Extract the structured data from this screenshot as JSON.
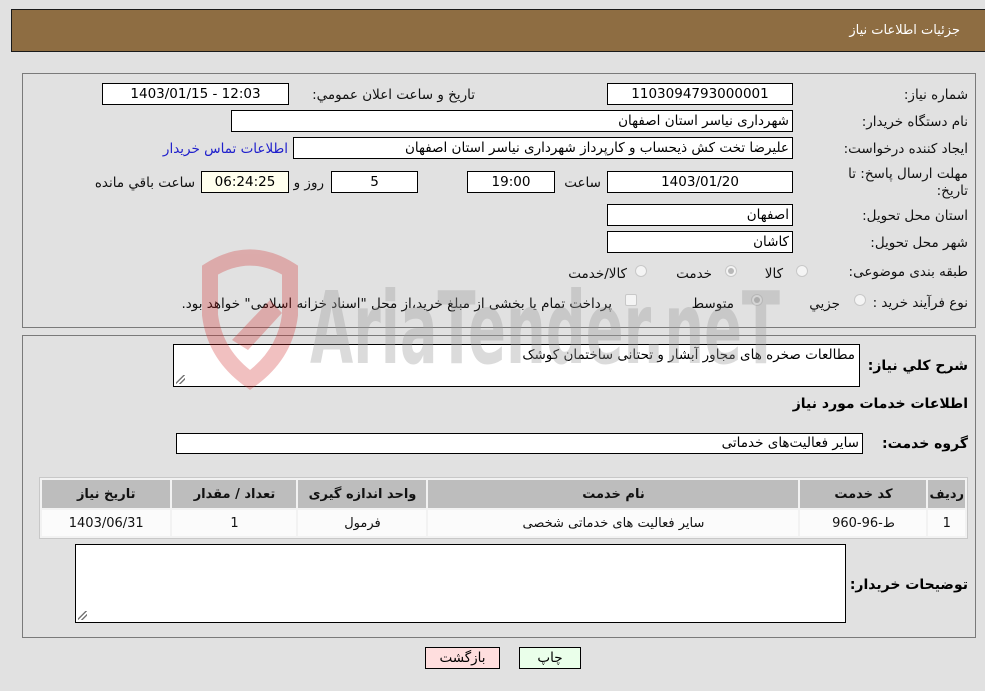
{
  "header": {
    "title": "جزئیات اطلاعات نیاز"
  },
  "form": {
    "need_number": {
      "label": "شماره نیاز:",
      "value": "1103094793000001"
    },
    "announce_datetime": {
      "label": "تاریخ و ساعت اعلان عمومي:",
      "value": "1403/01/15 - 12:03"
    },
    "buyer_org": {
      "label": "نام دستگاه خريدار:",
      "value": "شهرداری نیاسر استان اصفهان"
    },
    "requester": {
      "label": "ایجاد کننده درخواست:",
      "value": "علیرضا  تخت کش ذیحساب و کارپرداز شهرداری نیاسر استان اصفهان"
    },
    "buyer_contact_link": "اطلاعات تماس خريدار",
    "deadline": {
      "label": "مهلت ارسال پاسخ: تا تاریخ:",
      "date": "1403/01/20",
      "time_label": "ساعت",
      "time": "19:00",
      "days": "5",
      "days_label": "روز و",
      "remaining": "06:24:25",
      "remaining_label": "ساعت باقي مانده"
    },
    "delivery_province": {
      "label": "استان محل تحویل:",
      "value": "اصفهان"
    },
    "delivery_city": {
      "label": "شهر محل تحویل:",
      "value": "کاشان"
    },
    "category": {
      "label": "طبقه بندی موضوعی:",
      "options": [
        "کالا",
        "خدمت",
        "کالا/خدمت"
      ],
      "selected": "خدمت"
    },
    "purchase_type": {
      "label": "نوع فرآیند خرید :",
      "options": [
        "جزیي",
        "متوسط"
      ],
      "selected": "متوسط",
      "treasury_checkbox_label": "پرداخت تمام یا بخشی از مبلغ خرید،از محل \"اسناد خزانه اسلامی\" خواهد بود.",
      "treasury_checked": false
    }
  },
  "details": {
    "description_label": "شرح کلي نیاز:",
    "description": "مطالعات صخره های مجاور آبشار و تحتانی ساختمان کوشک",
    "services_heading": "اطلاعات خدمات مورد نیاز",
    "service_group_label": "گروه خدمت:",
    "service_group": "سایر فعالیت‌های خدماتی",
    "table": {
      "headers": [
        "ردیف",
        "کد خدمت",
        "نام خدمت",
        "واحد اندازه گیری",
        "تعداد / مقدار",
        "تاریخ نیاز"
      ],
      "rows": [
        [
          "1",
          "ط-96-960",
          "سایر فعالیت های خدماتی شخصی",
          "فرمول",
          "1",
          "1403/06/31"
        ]
      ]
    },
    "buyer_notes_label": "توضیحات خریدار:",
    "buyer_notes": ""
  },
  "buttons": {
    "print": "چاپ",
    "back": "بازگشت"
  },
  "colors": {
    "header_bg": "#8e6d42",
    "print_bg": "#eaffea",
    "back_bg": "#ffdede",
    "link": "#2020cc"
  },
  "watermark": {
    "text": "AriaTender.neT"
  }
}
